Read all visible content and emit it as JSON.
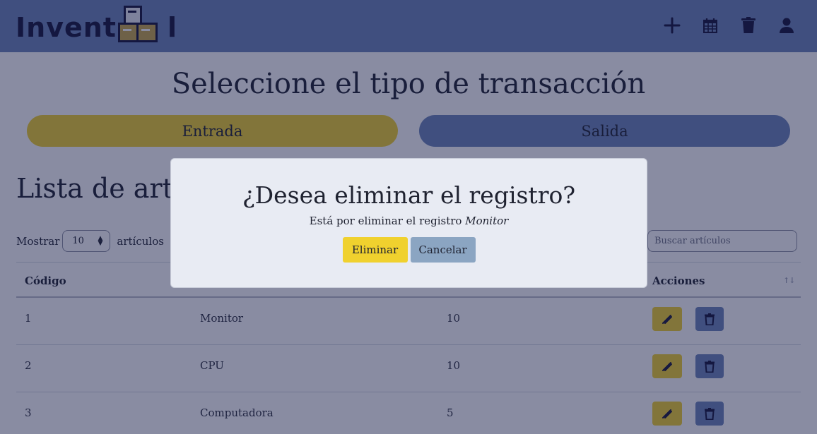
{
  "header": {
    "logo_text": "Invent",
    "logo_tail": "l",
    "icons": [
      "plus-icon",
      "calendar-icon",
      "trash-icon",
      "user-icon"
    ]
  },
  "main": {
    "title": "Seleccione el tipo de transacción",
    "transaction_buttons": {
      "entrada": "Entrada",
      "salida": "Salida"
    },
    "list_title": "Lista de artículos",
    "show_label": "Mostrar",
    "show_value": "10",
    "show_suffix": "artículos",
    "search_placeholder": "Buscar artículos"
  },
  "table": {
    "headers": {
      "codigo": "Código",
      "acciones": "Acciones"
    },
    "rows": [
      {
        "codigo": "1",
        "nombre": "Monitor",
        "cantidad": "10"
      },
      {
        "codigo": "2",
        "nombre": "CPU",
        "cantidad": "10"
      },
      {
        "codigo": "3",
        "nombre": "Computadora",
        "cantidad": "5"
      }
    ]
  },
  "modal": {
    "title": "¿Desea eliminar el registro?",
    "text": "Está por eliminar el registro",
    "record_name": "Monitor",
    "confirm_label": "Eliminar",
    "cancel_label": "Cancelar"
  },
  "colors": {
    "header_bg": "#6c85b8",
    "accent_yellow": "#f0d12e",
    "accent_blue": "#6c85b8",
    "overlay": "rgba(20,25,70,0.5)",
    "modal_bg": "#e8ebf3"
  }
}
